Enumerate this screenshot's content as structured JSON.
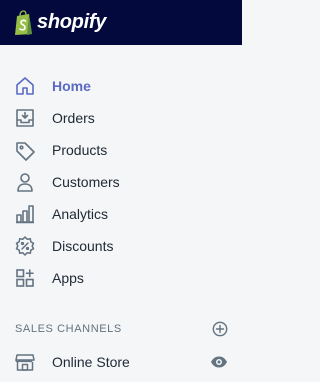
{
  "header": {
    "brand": "shopify",
    "background_color": "#03093c",
    "logo_color": "#95bf47"
  },
  "nav": {
    "accent_color": "#5c6ac4",
    "items": [
      {
        "label": "Home",
        "icon": "home-icon",
        "active": true
      },
      {
        "label": "Orders",
        "icon": "orders-inbox-icon",
        "active": false
      },
      {
        "label": "Products",
        "icon": "tag-icon",
        "active": false
      },
      {
        "label": "Customers",
        "icon": "person-icon",
        "active": false
      },
      {
        "label": "Analytics",
        "icon": "bar-chart-icon",
        "active": false
      },
      {
        "label": "Discounts",
        "icon": "discount-badge-icon",
        "active": false
      },
      {
        "label": "Apps",
        "icon": "apps-grid-icon",
        "active": false
      }
    ]
  },
  "sales_channels": {
    "title": "SALES CHANNELS",
    "add_icon": "add-circle-icon",
    "items": [
      {
        "label": "Online Store",
        "icon": "storefront-icon",
        "action_icon": "eye-icon"
      }
    ]
  }
}
